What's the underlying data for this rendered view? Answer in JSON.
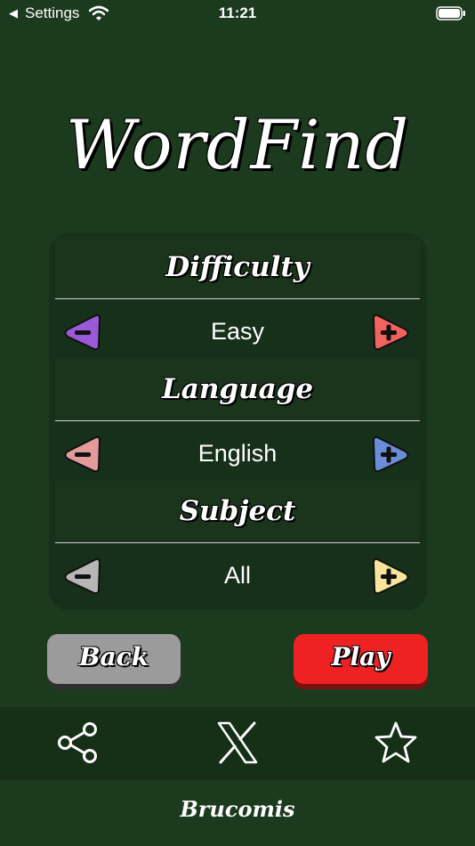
{
  "status_bar": {
    "back_label": "Settings",
    "time": "11:21"
  },
  "app_title": "WordFind",
  "settings": [
    {
      "heading": "Difficulty",
      "value": "Easy",
      "minus_color": "#9a5ad8",
      "plus_color": "#f2625e"
    },
    {
      "heading": "Language",
      "value": "English",
      "minus_color": "#e29a9a",
      "plus_color": "#6a8ed6"
    },
    {
      "heading": "Subject",
      "value": "All",
      "minus_color": "#b6b6b6",
      "plus_color": "#f6e59a"
    }
  ],
  "buttons": {
    "back": "Back",
    "play": "Play"
  },
  "footer": {
    "icons": [
      "share-icon",
      "x-logo-icon",
      "star-icon"
    ],
    "brand": "Brucomis"
  },
  "colors": {
    "background": "#1c3a1e",
    "panel": "#17301a",
    "play": "#ee2222",
    "back": "#9b9b9b"
  }
}
